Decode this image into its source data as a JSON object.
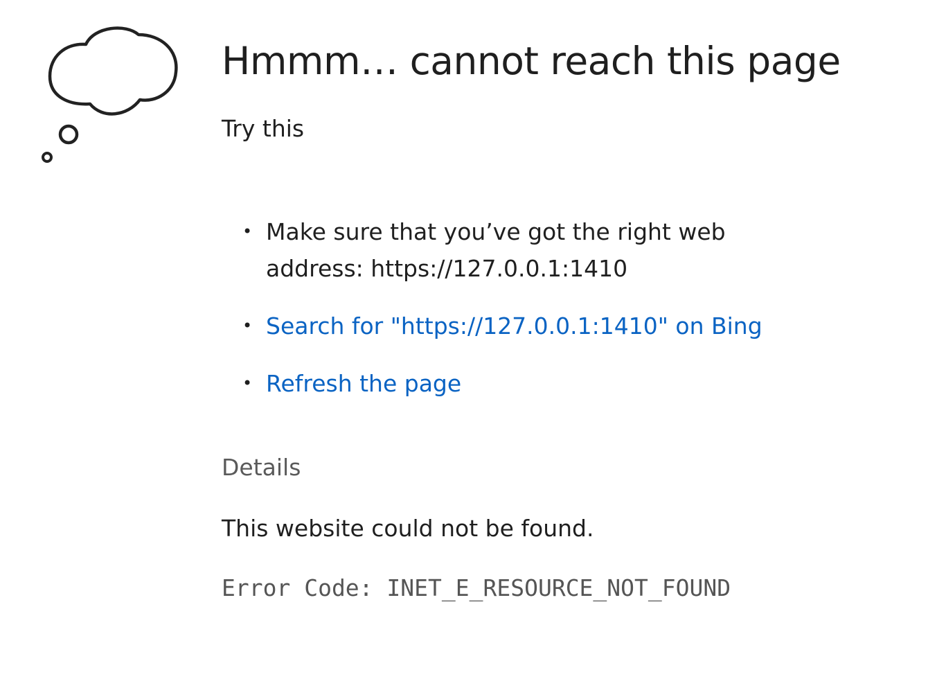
{
  "page": {
    "title": "Hmmm… cannot reach this page",
    "subtitle": "Try this"
  },
  "suggestions": [
    {
      "text": "Make sure that you’ve got the right web address: https://127.0.0.1:1410"
    },
    {
      "text": "Search for \"https://127.0.0.1:1410\" on Bing"
    },
    {
      "text": "Refresh the page"
    }
  ],
  "details": {
    "heading": "Details",
    "message": "This website could not be found.",
    "error_code": "Error Code: INET_E_RESOURCE_NOT_FOUND"
  },
  "icons": {
    "illustration": "thought-cloud-icon"
  },
  "colors": {
    "link": "#0a63c3",
    "text": "#1f1f1f",
    "muted": "#5a5a5a"
  }
}
